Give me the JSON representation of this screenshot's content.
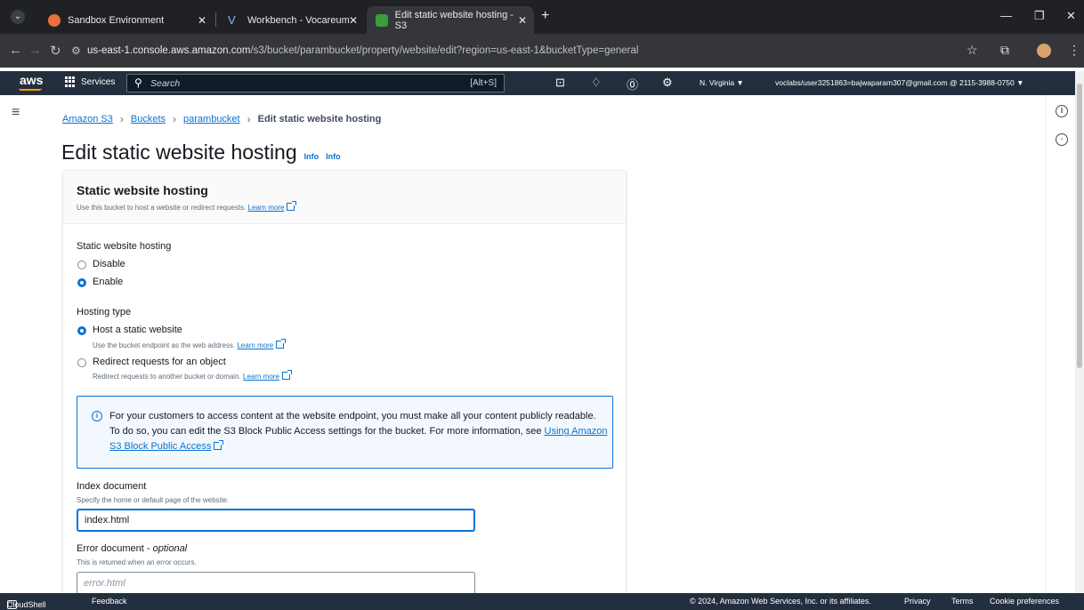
{
  "browser": {
    "tabs": [
      {
        "title": "Sandbox Environment",
        "active": false
      },
      {
        "title": "Workbench - Vocareum",
        "active": false
      },
      {
        "title": "Edit static website hosting - S3",
        "active": true
      }
    ],
    "url_host": "us-east-1.console.aws.amazon.com",
    "url_path": "/s3/bucket/parambucket/property/website/edit?region=us-east-1&bucketType=general"
  },
  "aws_nav": {
    "logo": "aws",
    "services_label": "Services",
    "search_placeholder": "Search",
    "search_shortcut": "[Alt+S]",
    "region": "N. Virginia ▼",
    "account": "voclabs/user3251863=bajwaparam307@gmail.com @ 2115-3988-0750 ▼"
  },
  "breadcrumb": {
    "items": [
      "Amazon S3",
      "Buckets",
      "parambucket"
    ],
    "current": "Edit static website hosting"
  },
  "page": {
    "title": "Edit static website hosting",
    "info_links": [
      "Info",
      "Info"
    ]
  },
  "panel": {
    "title": "Static website hosting",
    "description": "Use this bucket to host a website or redirect requests.",
    "learn_more": "Learn more",
    "hosting_label": "Static website hosting",
    "hosting_options": [
      "Disable",
      "Enable"
    ],
    "hosting_selected": "Enable",
    "type_label": "Hosting type",
    "type_options": [
      {
        "label": "Host a static website",
        "desc": "Use the bucket endpoint as the web address.",
        "link": "Learn more",
        "selected": true
      },
      {
        "label": "Redirect requests for an object",
        "desc": "Redirect requests to another bucket or domain.",
        "link": "Learn more",
        "selected": false
      }
    ],
    "alert_text": "For your customers to access content at the website endpoint, you must make all your content publicly readable. To do so, you can edit the S3 Block Public Access settings for the bucket. For more information, see",
    "alert_link": "Using Amazon S3 Block Public Access",
    "index_label": "Index document",
    "index_desc": "Specify the home or default page of the website.",
    "index_value": "index.html",
    "error_label": "Error document - ",
    "error_optional": "optional",
    "error_desc": "This is returned when an error occurs.",
    "error_placeholder": "error.html"
  },
  "footer": {
    "cloudshell": "CloudShell",
    "feedback": "Feedback",
    "copyright": "© 2024, Amazon Web Services, Inc. or its affiliates.",
    "privacy": "Privacy",
    "terms": "Terms",
    "cookies": "Cookie preferences"
  },
  "colors": {
    "aws_nav": "#232f3e",
    "link": "#0972d3",
    "accent": "#ff9900"
  }
}
